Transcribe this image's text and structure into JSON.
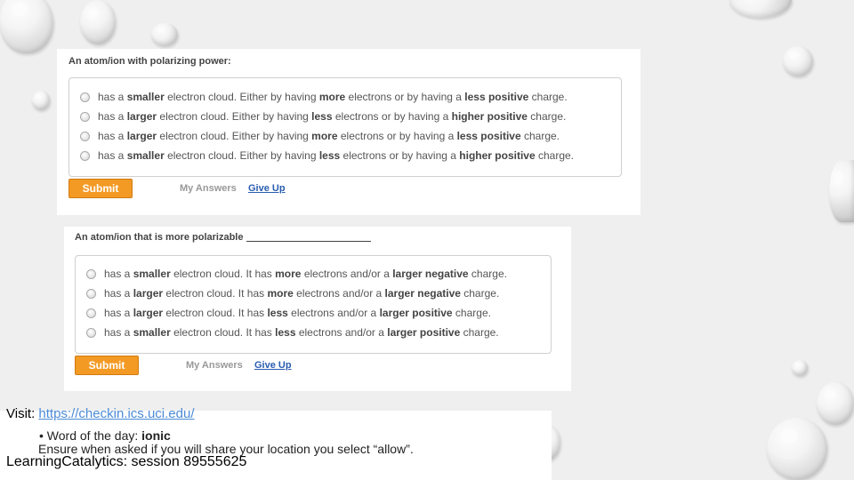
{
  "question1": {
    "title": "An atom/ion with polarizing power:",
    "options": [
      [
        "has a ",
        "smaller",
        " electron cloud. Either by having ",
        "more",
        " electrons or by having a ",
        "less positive",
        " charge."
      ],
      [
        "has a ",
        "larger",
        " electron cloud. Either by having ",
        "less",
        " electrons or by having a ",
        "higher positive",
        " charge."
      ],
      [
        "has a ",
        "larger",
        " electron cloud. Either by having ",
        "more",
        " electrons or by having a ",
        "less positive",
        " charge."
      ],
      [
        "has a ",
        "smaller",
        " electron cloud. Either by having ",
        "less",
        " electrons or by having a ",
        "higher positive",
        " charge."
      ]
    ],
    "submit_label": "Submit",
    "my_answers_label": "My Answers",
    "give_up_label": "Give Up"
  },
  "question2": {
    "title": "An atom/ion that is more polarizable",
    "options": [
      [
        "has a ",
        "smaller",
        " electron cloud. It has ",
        "more",
        " electrons and/or a ",
        "larger negative",
        " charge."
      ],
      [
        "has a ",
        "larger",
        " electron cloud. It has ",
        "more",
        " electrons and/or a ",
        "larger negative",
        " charge."
      ],
      [
        "has a ",
        "larger",
        " electron cloud. It has ",
        "less",
        " electrons and/or a ",
        "larger positive",
        " charge."
      ],
      [
        "has a ",
        "smaller",
        " electron cloud. It has ",
        "less",
        " electrons and/or a ",
        "larger positive",
        " charge."
      ]
    ],
    "submit_label": "Submit",
    "my_answers_label": "My Answers",
    "give_up_label": "Give Up"
  },
  "footer": {
    "visit_label": "Visit: ",
    "visit_url": "https://checkin.ics.uci.edu/",
    "bullet_prefix": "•  Word of the day: ",
    "bullet_word": "ionic",
    "ensure_text": "Ensure when asked if you will share your location you select “allow”.",
    "session_text": "LearningCatalytics: session 89555625"
  },
  "colors": {
    "submit": "#f39a25",
    "link": "#4b8bd6",
    "give_up": "#2a5db0"
  }
}
